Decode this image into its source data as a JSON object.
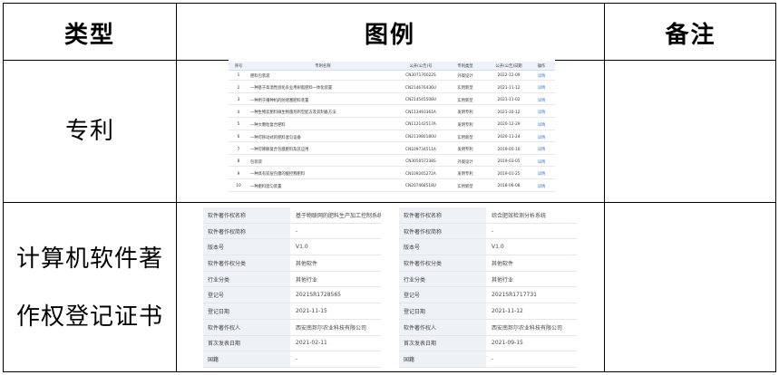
{
  "headers": {
    "type": "类型",
    "example": "图例",
    "remark": "备注"
  },
  "categories": {
    "patent": "专利",
    "software_line1": "计算机软件著",
    "software_line2": "作权登记证书"
  },
  "patent_table": {
    "columns": [
      "序号",
      "专利名称",
      "公开(公告)号",
      "专利类型",
      "公开(公告)日期",
      "操作"
    ],
    "rows": [
      [
        "1",
        "肥料包装袋",
        "CN307176022S",
        "外观设计",
        "2022-12-09",
        "详情"
      ],
      [
        "2",
        "一种基于高温性固化农业用树脂肥料一体化装置",
        "CN214676436U",
        "实用新型",
        "2021-11-12",
        "详情"
      ],
      [
        "3",
        "一种用于播种机的防堵塞肥料装置",
        "CN214545508U",
        "实用新型",
        "2021-11-02",
        "详情"
      ],
      [
        "4",
        "一种生物炭肥料微生物菌剂剂型配方及其制备方法",
        "CN113493361A",
        "发明专利",
        "2021-10-12",
        "详情"
      ],
      [
        "5",
        "一种大颗粒复合肥料",
        "CN112142517A",
        "发明专利",
        "2020-12-29",
        "详情"
      ],
      [
        "6",
        "一种可移动式的肥料混匀设备",
        "CN211980180U",
        "实用新型",
        "2020-11-24",
        "详情"
      ],
      [
        "7",
        "一种可降解复合包膜肥料及其应用",
        "CN109734511A",
        "发明专利",
        "2019-05-10",
        "详情"
      ],
      [
        "8",
        "包装袋",
        "CN305057238S",
        "外观设计",
        "2019-03-05",
        "详情"
      ],
      [
        "9",
        "一种具有双层包膜的缓控释肥料",
        "CN109265272A",
        "发明专利",
        "2019-01-25",
        "详情"
      ],
      [
        "10",
        "一种肥料混匀装置",
        "CN207468518U",
        "实用新型",
        "2018-06-08",
        "详情"
      ]
    ]
  },
  "software_records": {
    "left": [
      [
        "软件著作权名称",
        "基于物联网的肥料生产加工控制系统"
      ],
      [
        "软件著作权简称",
        "-"
      ],
      [
        "版本号",
        "V1.0"
      ],
      [
        "软件著作权分类",
        "其他软件"
      ],
      [
        "行业分类",
        "其他行业"
      ],
      [
        "登记号",
        "2021SR1728565"
      ],
      [
        "登记日期",
        "2021-11-15"
      ],
      [
        "软件著作权人",
        "西安南邦尔农业科技有限公司"
      ],
      [
        "首次发表日期",
        "2021-02-11"
      ],
      [
        "国籍",
        "-"
      ]
    ],
    "right": [
      [
        "软件著作权名称",
        "综合肥效检测分析系统"
      ],
      [
        "软件著作权简称",
        "-"
      ],
      [
        "版本号",
        "V1.0"
      ],
      [
        "软件著作权分类",
        "其他软件"
      ],
      [
        "行业分类",
        "其他行业"
      ],
      [
        "登记号",
        "2021SR1717731"
      ],
      [
        "登记日期",
        "2021-11-12"
      ],
      [
        "软件著作权人",
        "西安南邦尔农业科技有限公司"
      ],
      [
        "首次发表日期",
        "2021-09-15"
      ],
      [
        "国籍",
        "-"
      ]
    ]
  }
}
